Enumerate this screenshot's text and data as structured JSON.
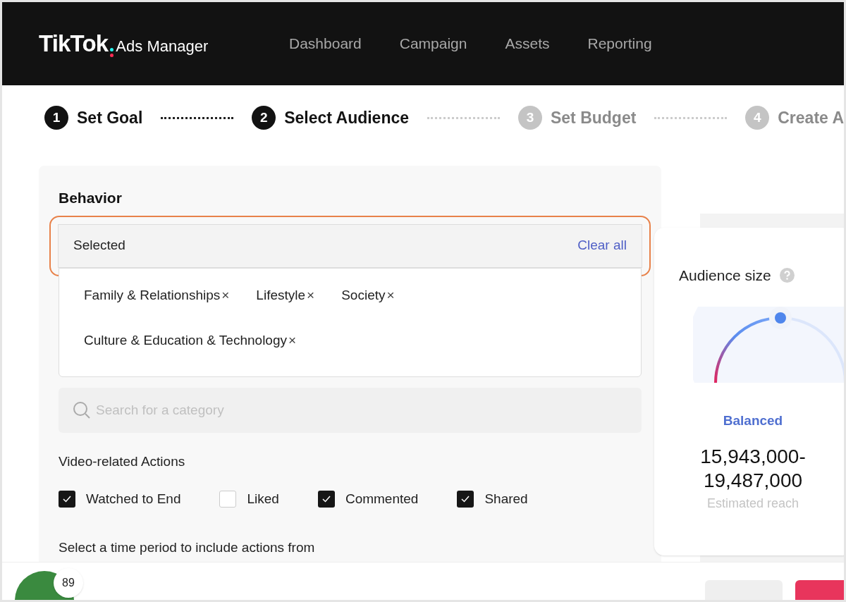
{
  "header": {
    "logo": "TikTok",
    "logo_suffix": "Ads Manager",
    "nav": [
      {
        "label": "Dashboard"
      },
      {
        "label": "Campaign"
      },
      {
        "label": "Assets"
      },
      {
        "label": "Reporting"
      }
    ]
  },
  "steps": [
    {
      "number": "1",
      "label": "Set Goal",
      "done": true
    },
    {
      "number": "2",
      "label": "Select Audience",
      "done": true
    },
    {
      "number": "3",
      "label": "Set Budget",
      "done": false
    },
    {
      "number": "4",
      "label": "Create A",
      "done": false
    }
  ],
  "behavior": {
    "title": "Behavior",
    "selected_label": "Selected",
    "clear_all": "Clear all",
    "tags": [
      {
        "label": "Family & Relationships",
        "remove": "×"
      },
      {
        "label": "Lifestyle",
        "remove": "×"
      },
      {
        "label": "Society",
        "remove": "×"
      },
      {
        "label": "Culture & Education & Technology",
        "remove": "×"
      }
    ],
    "search": {
      "placeholder": "Search for a category"
    },
    "actions_title": "Video-related Actions",
    "actions": [
      {
        "label": "Watched to End",
        "checked": true
      },
      {
        "label": "Liked",
        "checked": false
      },
      {
        "label": "Commented",
        "checked": true
      },
      {
        "label": "Shared",
        "checked": true
      }
    ],
    "time_period": "Select a time period to include actions from"
  },
  "audience": {
    "title": "Audience size",
    "status": "Balanced",
    "range": "15,943,000-\n19,487,000",
    "caption": "Estimated reach"
  },
  "footer": {
    "badge_count": "89"
  }
}
